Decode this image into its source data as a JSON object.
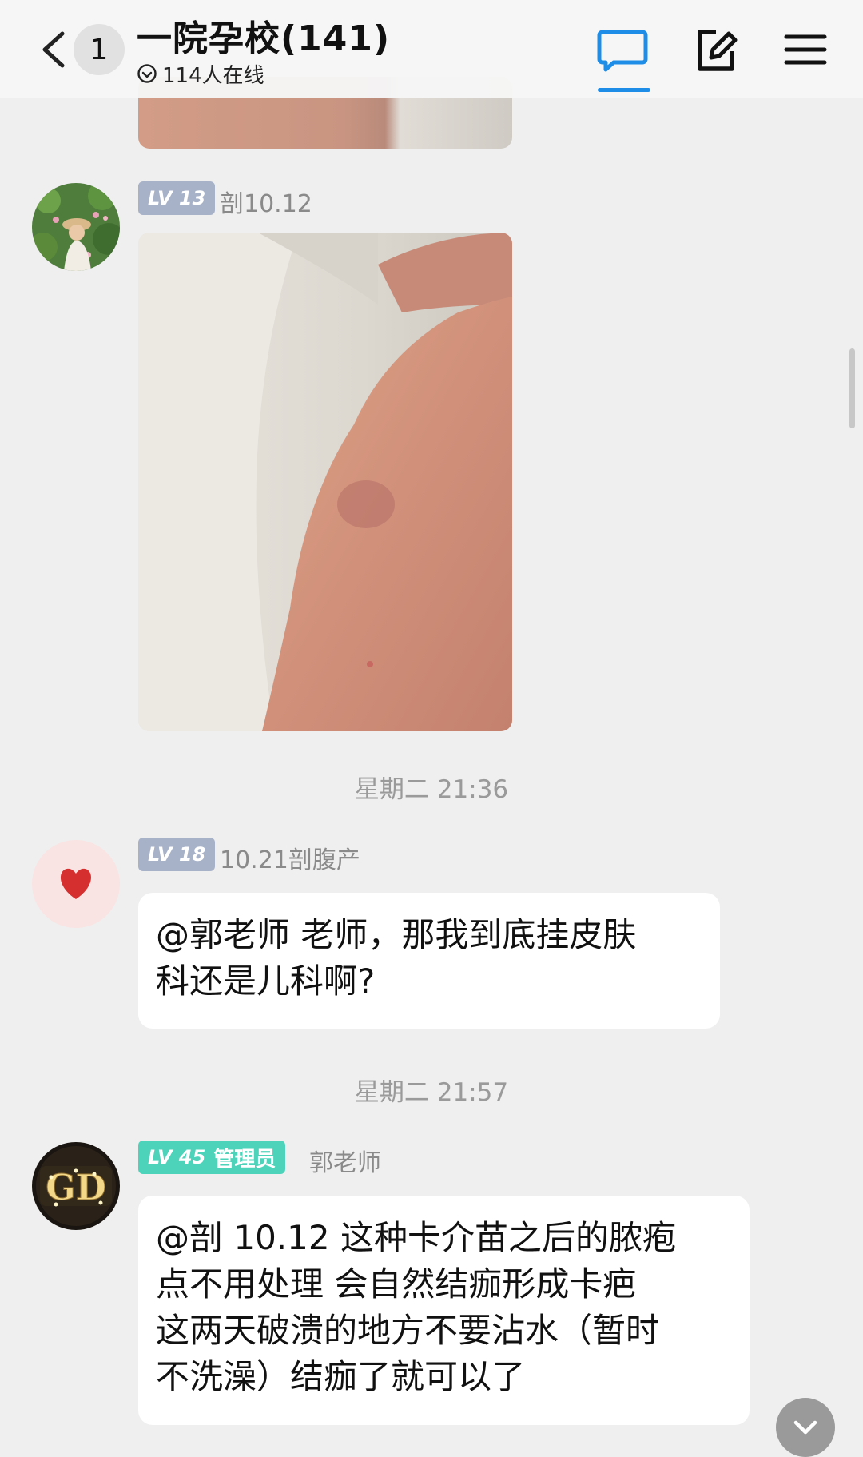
{
  "header": {
    "unread_count": "1",
    "group_title": "一院孕校(141)",
    "online_text": "114人在线"
  },
  "messages": [
    {
      "level": "LV 13",
      "sender": "剖10.12",
      "type": "image"
    },
    {
      "timestamp": "星期二 21:36",
      "level": "LV 18",
      "sender": "10.21剖腹产",
      "text_lines": [
        "@郭老师 老师，那我到底挂皮肤",
        "科还是儿科啊?"
      ]
    },
    {
      "timestamp": "星期二 21:57",
      "level": "LV 45",
      "role": "管理员",
      "sender": "郭老师",
      "text_lines": [
        "@剖 10.12 这种卡介苗之后的脓疱",
        "点不用处理 会自然结痂形成卡疤",
        "这两天破溃的地方不要沾水（暂时",
        "不洗澡）结痂了就可以了"
      ]
    }
  ],
  "colors": {
    "accent": "#1e8de8",
    "admin_badge": "#4dd3ba",
    "level_badge": "#a7b2c8",
    "background": "#efefef"
  },
  "icons": [
    "back-icon",
    "online-status-icon",
    "chat-tab-icon",
    "edit-icon",
    "menu-icon",
    "heart-icon",
    "chevron-down-icon"
  ]
}
